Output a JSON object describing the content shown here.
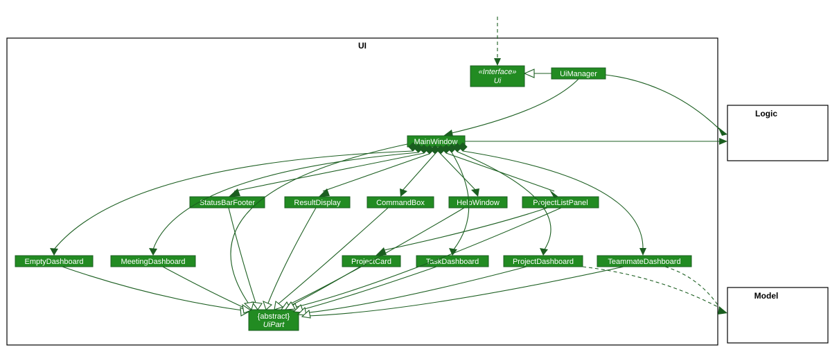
{
  "packages": {
    "ui": {
      "label": "UI"
    },
    "logic": {
      "label": "Logic"
    },
    "model": {
      "label": "Model"
    }
  },
  "classes": {
    "uiInterface": {
      "stereotype": "«Interface»",
      "name": "Ui"
    },
    "uiManager": {
      "name": "UiManager"
    },
    "mainWindow": {
      "name": "MainWindow"
    },
    "statusBarFooter": {
      "name": "StatusBarFooter"
    },
    "resultDisplay": {
      "name": "ResultDisplay"
    },
    "commandBox": {
      "name": "CommandBox"
    },
    "helpWindow": {
      "name": "HelpWindow"
    },
    "projectListPanel": {
      "name": "ProjectListPanel"
    },
    "emptyDashboard": {
      "name": "EmptyDashboard"
    },
    "meetingDashboard": {
      "name": "MeetingDashboard"
    },
    "projectCard": {
      "name": "ProjectCard"
    },
    "taskDashboard": {
      "name": "TaskDashboard"
    },
    "projectDashboard": {
      "name": "ProjectDashboard"
    },
    "teammateDashboard": {
      "name": "TeammateDashboard"
    },
    "uiPart": {
      "stereotype": "{abstract}",
      "name": "UiPart"
    }
  }
}
